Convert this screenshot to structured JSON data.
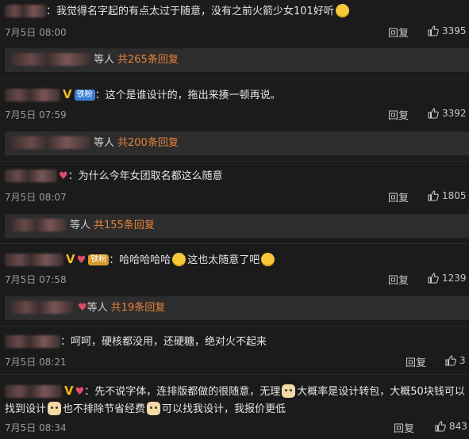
{
  "comments": [
    {
      "text": "：我觉得名字起的有点太过于随意，没有之前火箭少女101好听",
      "time": "7月5日 08:00",
      "reply_label": "回复",
      "likes": "3395",
      "sub_suffix": "等人",
      "sub_count": "共265条回复"
    },
    {
      "fan_badge": "铁粉",
      "text": "：这个是谁设计的，拖出来揍一顿再说。",
      "time": "7月5日 07:59",
      "reply_label": "回复",
      "likes": "3392",
      "sub_suffix": "等人",
      "sub_count": "共200条回复"
    },
    {
      "text": "：为什么今年女团取名都这么随意",
      "time": "7月5日 08:07",
      "reply_label": "回复",
      "likes": "1805",
      "sub_suffix": "等人",
      "sub_count": "共155条回复"
    },
    {
      "fan_badge": "铁粉",
      "text_a": "：哈哈哈哈哈",
      "text_b": "这也太随意了吧",
      "time": "7月5日 07:58",
      "reply_label": "回复",
      "likes": "1239",
      "sub_suffix": "等人",
      "sub_count": "共19条回复"
    },
    {
      "text": "：呵呵，硬核都没用，还硬糖，绝对火不起来",
      "time": "7月5日 08:21",
      "reply_label": "回复",
      "likes": "3"
    },
    {
      "text_a": "：先不说字体，连排版都做的很随意，无理",
      "text_b": "大概率是设计转包，大概50块钱",
      "text_c": "可以找到设计",
      "text_d": "也不排除节省经费",
      "text_e": "可以找我设计，我报价更低",
      "time": "7月5日 08:34",
      "reply_label": "回复",
      "likes": "843"
    }
  ],
  "colors": {
    "background": "#1b1b1b",
    "sub_bar": "#2d2d2d",
    "reply_count": "#e8823a",
    "vip_v": "#f5b71a",
    "fan_badge": "#3b7fd4"
  },
  "icons": [
    "thumbs-up-icon",
    "grin-emoji",
    "laugh-emoji",
    "doge-emoji",
    "heart-badge-icon"
  ]
}
